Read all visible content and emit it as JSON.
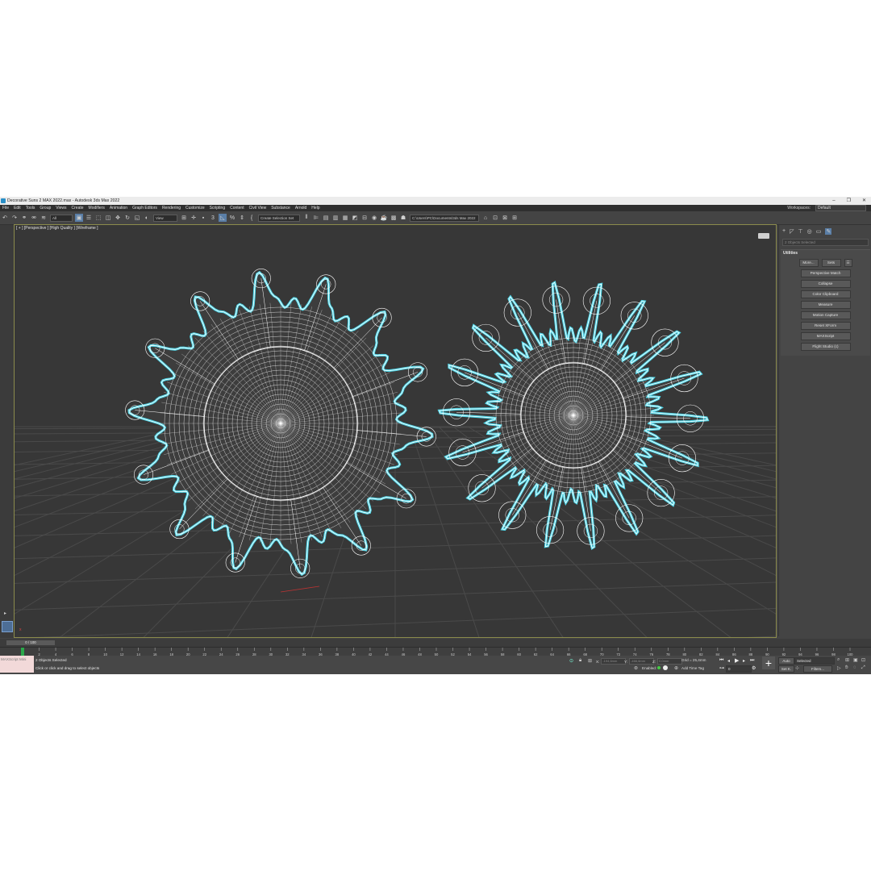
{
  "window": {
    "title": "Decorative Suns 2 MAX 2022.max - Autodesk 3ds Max 2022",
    "minimize": "–",
    "maximize": "❐",
    "close": "✕"
  },
  "menu": {
    "items": [
      "File",
      "Edit",
      "Tools",
      "Group",
      "Views",
      "Create",
      "Modifiers",
      "Animation",
      "Graph Editors",
      "Rendering",
      "Customize",
      "Scripting",
      "Content",
      "Civil View",
      "Substance",
      "Arnold",
      "Help"
    ],
    "workspaces_label": "Workspaces:",
    "workspace_value": "Default"
  },
  "toolbar": {
    "filter_value": "All",
    "refcoord_value": "View",
    "selection_set": "Create Selection Set",
    "project_path": "C:\\Users\\PC\\Documents\\3ds Max 2022"
  },
  "viewport": {
    "label": "[ + ] [Perspective ] [High Quality ] [Wireframe ]"
  },
  "command_panel": {
    "object_field": "2 Objects Selected",
    "rollout_title": "Utilities",
    "more_button": "More...",
    "sets_button": "Sets",
    "utilities": [
      "Perspective Match",
      "Collapse",
      "Color Clipboard",
      "Measure",
      "Motion Capture",
      "Reset XForm",
      "MAXScript",
      "Flight Studio (c)"
    ]
  },
  "timeline": {
    "slider_label": "0 / 100",
    "ticks": [
      "0",
      "2",
      "4",
      "6",
      "8",
      "10",
      "12",
      "14",
      "16",
      "18",
      "20",
      "22",
      "24",
      "26",
      "28",
      "30",
      "32",
      "34",
      "36",
      "38",
      "40",
      "42",
      "44",
      "46",
      "48",
      "50",
      "52",
      "54",
      "56",
      "58",
      "60",
      "62",
      "64",
      "66",
      "68",
      "70",
      "72",
      "74",
      "76",
      "78",
      "80",
      "82",
      "84",
      "86",
      "88",
      "90",
      "92",
      "94",
      "96",
      "98",
      "100"
    ]
  },
  "status": {
    "maxscript_label": "MAXScript Mini",
    "selection_text": "2 Objects Selected",
    "prompt_text": "Click or click and drag to select objects",
    "x_label": "X:",
    "x_value": "-194,6mm",
    "y_label": "Y:",
    "y_value": "-466,6mm",
    "z_label": "Z:",
    "z_value": "0,0mm",
    "grid_text": "Grid = 25,4mm",
    "enabled_label": "Enabled:",
    "add_time_tag": "Add Time Tag",
    "auto_label": "Auto",
    "selected_label": "Selected",
    "set_key_label": "Set K.",
    "filters_label": "Filters...",
    "frame_value": "0"
  },
  "colors": {
    "app_bg": "#444444",
    "viewport_bg": "#373737",
    "selection_outline": "#4fd6e8",
    "wire": "#ffffff"
  }
}
